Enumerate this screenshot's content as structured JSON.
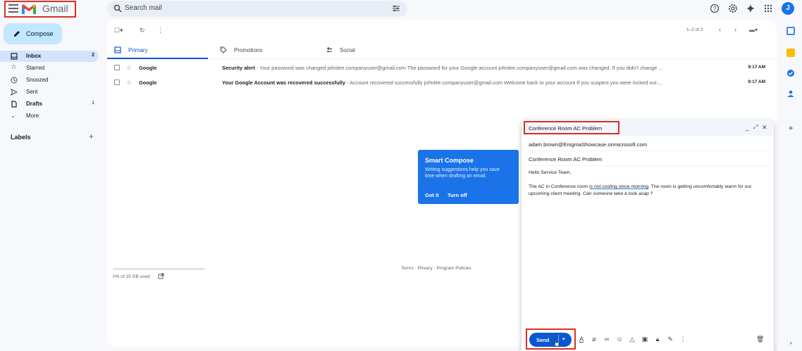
{
  "app": {
    "name": "Gmail",
    "avatar_letter": "J",
    "accent": "#0b57d0",
    "highlight": "#d93025"
  },
  "search": {
    "placeholder": "Search mail"
  },
  "sidebar": {
    "compose_label": "Compose",
    "items": [
      {
        "label": "Inbox",
        "count": "2",
        "icon": "inbox-icon"
      },
      {
        "label": "Starred",
        "count": "",
        "icon": "star-icon"
      },
      {
        "label": "Snoozed",
        "count": "",
        "icon": "clock-icon"
      },
      {
        "label": "Sent",
        "count": "",
        "icon": "send-icon"
      },
      {
        "label": "Drafts",
        "count": "1",
        "icon": "draft-icon"
      },
      {
        "label": "More",
        "count": "",
        "icon": "chevron-down-icon"
      }
    ],
    "labels_title": "Labels"
  },
  "toolbar": {
    "pager": "1–2 of 2"
  },
  "tabs": [
    {
      "label": "Primary"
    },
    {
      "label": "Promotions"
    },
    {
      "label": "Social"
    }
  ],
  "emails": [
    {
      "sender": "Google",
      "subject": "Security alert",
      "snippet": " - Your password was changed johnlee.companyuser@gmail.com The password for your Google account johnlee.companyuser@gmail.com was changed. If you didn't change ...",
      "time": "9:17 AM"
    },
    {
      "sender": "Google",
      "subject": "Your Google Account was recovered successfully",
      "snippet": " - Account recovered successfully johnlee.companyuser@gmail.com Welcome back to your account If you suspect you were locked out ...",
      "time": "9:17 AM"
    }
  ],
  "footer": {
    "storage": "0% of 15 GB used",
    "links": "Terms · Privacy · Program Policies"
  },
  "smart_compose": {
    "title": "Smart Compose",
    "body": "Writing suggestions help you save time when drafting an email.",
    "got_it": "Got it",
    "turn_off": "Turn off"
  },
  "compose": {
    "window_title": "Conference Room AC Problem",
    "to": "adam.brown@EnigmaShowcase.onmicrosoft.com",
    "subject": "Conference Room AC Problem",
    "greeting": "Hello Service Team,",
    "body_before": "The AC in Conference room ",
    "body_underlined": "is not cooling since morning",
    "body_after": ". The room is getting uncomfortably warm for our upcoming client meeting. Can someone take a look asap ?",
    "send_label": "Send"
  }
}
